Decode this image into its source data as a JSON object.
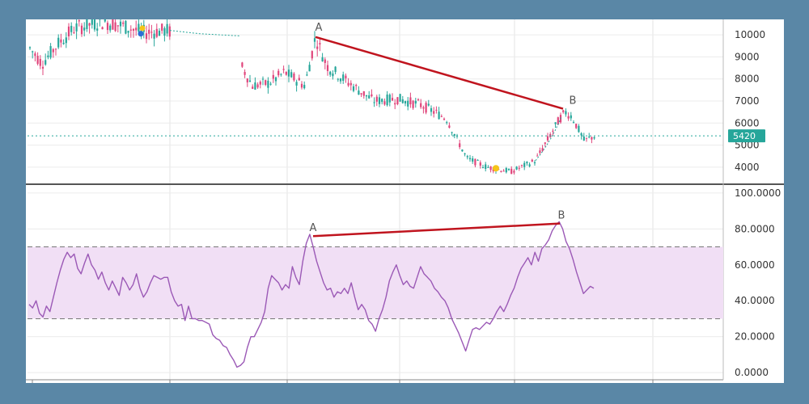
{
  "chart_data": [
    {
      "type": "candlestick",
      "panel": "price",
      "ylim": [
        3300,
        10700
      ],
      "yticks": [
        {
          "value": 4000,
          "label": "4000"
        },
        {
          "value": 5000,
          "label": "5000"
        },
        {
          "value": 6000,
          "label": "6000"
        },
        {
          "value": 7000,
          "label": "7000"
        },
        {
          "value": 8000,
          "label": "8000"
        },
        {
          "value": 9000,
          "label": "9000"
        },
        {
          "value": 10000,
          "label": "10000"
        }
      ],
      "current_price": {
        "value": 5420,
        "label": "5420",
        "color": "#26a69a"
      },
      "trendline": {
        "from": {
          "label": "A",
          "value": 9900
        },
        "to": {
          "label": "B",
          "value": 6650
        },
        "color": "#c0141e"
      },
      "point_labels": [
        "A",
        "B"
      ],
      "up_color": "#26a69a",
      "down_color": "#e0457b"
    },
    {
      "type": "line",
      "panel": "oscillator",
      "ylim": [
        -4,
        104
      ],
      "yticks": [
        {
          "value": 0,
          "label": "0.0000"
        },
        {
          "value": 20,
          "label": "20.0000"
        },
        {
          "value": 40,
          "label": "40.0000"
        },
        {
          "value": 60,
          "label": "60.0000"
        },
        {
          "value": 80,
          "label": "80.0000"
        },
        {
          "value": 100,
          "label": "100.0000"
        }
      ],
      "band": {
        "lower": 30,
        "upper": 70,
        "fill": "#f1dff5",
        "border": "#777777"
      },
      "trendline": {
        "from": {
          "label": "A",
          "value": 76
        },
        "to": {
          "label": "B",
          "value": 83
        },
        "color": "#c0141e"
      },
      "point_labels": [
        "A",
        "B"
      ],
      "line_color": "#9b59b6",
      "values": [
        38,
        36,
        40,
        33,
        31,
        37,
        34,
        42,
        50,
        57,
        63,
        67,
        64,
        66,
        58,
        55,
        61,
        66,
        60,
        57,
        52,
        56,
        50,
        46,
        51,
        47,
        43,
        53,
        50,
        46,
        49,
        55,
        47,
        42,
        45,
        50,
        54,
        53,
        52,
        53,
        53,
        45,
        40,
        37,
        38,
        29,
        37,
        30,
        30,
        29,
        29,
        28,
        27,
        21,
        19,
        18,
        15,
        14,
        10,
        7,
        3,
        4,
        6,
        14,
        20,
        20,
        24,
        28,
        34,
        47,
        54,
        52,
        50,
        46,
        49,
        47,
        59,
        53,
        49,
        62,
        72,
        77,
        70,
        62,
        56,
        50,
        46,
        47,
        42,
        45,
        44,
        47,
        44,
        50,
        42,
        35,
        38,
        35,
        29,
        27,
        23,
        30,
        35,
        42,
        51,
        56,
        60,
        54,
        49,
        51,
        48,
        47,
        53,
        59,
        55,
        53,
        51,
        47,
        45,
        42,
        40,
        36,
        30,
        26,
        22,
        17,
        12,
        18,
        24,
        25,
        24,
        26,
        28,
        27,
        30,
        34,
        37,
        34,
        38,
        43,
        47,
        53,
        58,
        61,
        64,
        60,
        67,
        62,
        69,
        71,
        74,
        79,
        82,
        84,
        80,
        73,
        69,
        63,
        56,
        50,
        44,
        46,
        48,
        47
      ]
    }
  ]
}
